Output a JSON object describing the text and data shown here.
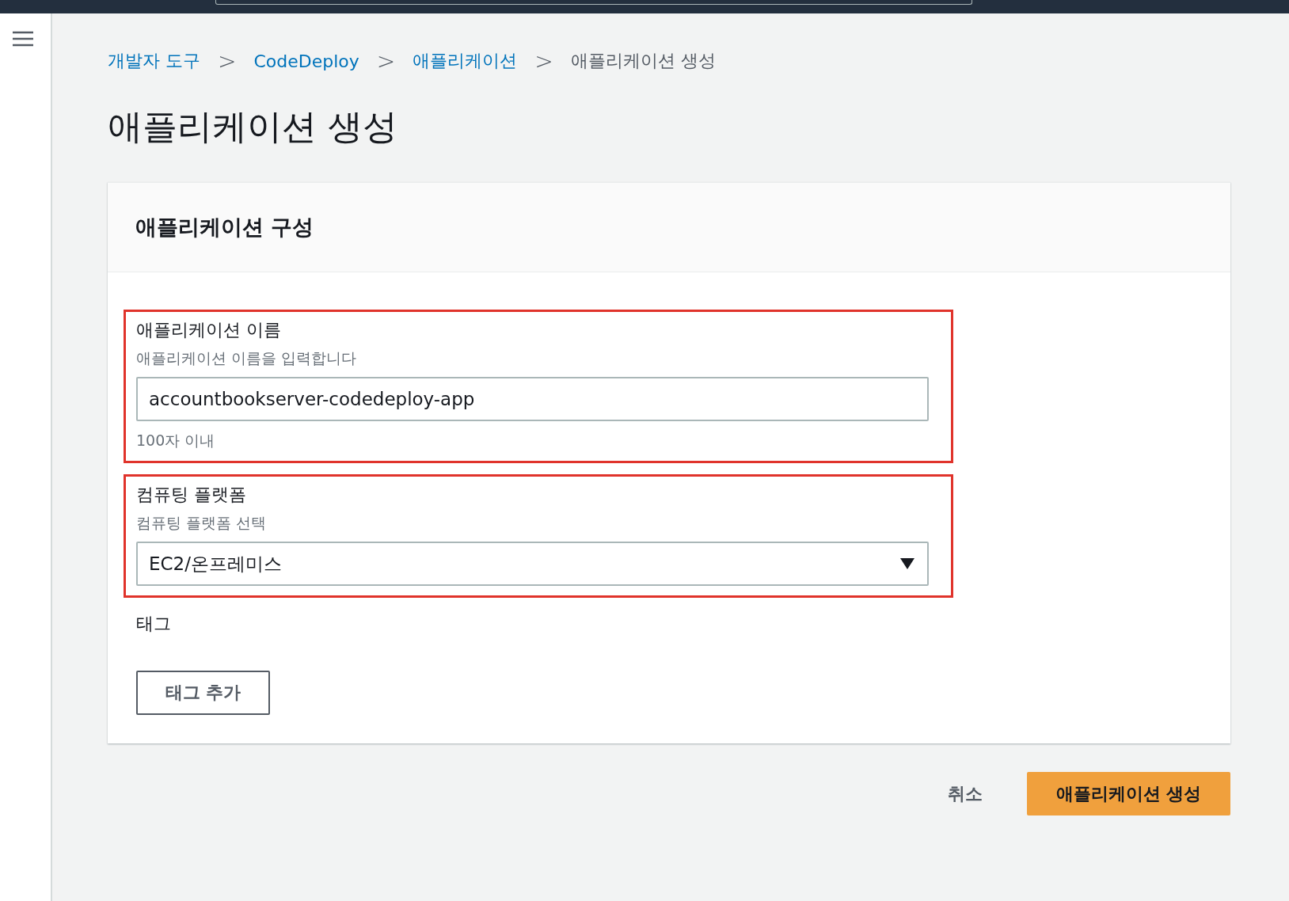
{
  "breadcrumb": [
    {
      "label": "개발자 도구",
      "link": true
    },
    {
      "label": "CodeDeploy",
      "link": true
    },
    {
      "label": "애플리케이션",
      "link": true
    },
    {
      "label": "애플리케이션 생성",
      "link": false
    }
  ],
  "separator": ">",
  "title": "애플리케이션 생성",
  "card": {
    "title": "애플리케이션 구성",
    "fields": [
      {
        "kind": "text",
        "label": "애플리케이션 이름",
        "description": "애플리케이션 이름을 입력합니다",
        "value": "accountbookserver-codedeploy-app",
        "constraint": "100자 이내",
        "highlighted": true
      },
      {
        "kind": "select",
        "label": "컴퓨팅 플랫폼",
        "description": "컴퓨팅 플랫폼 선택",
        "value": "EC2/온프레미스",
        "highlighted": true
      }
    ],
    "tags": {
      "label": "태그",
      "button": "태그 추가"
    }
  },
  "actions": {
    "cancel": "취소",
    "submit": "애플리케이션 생성"
  }
}
